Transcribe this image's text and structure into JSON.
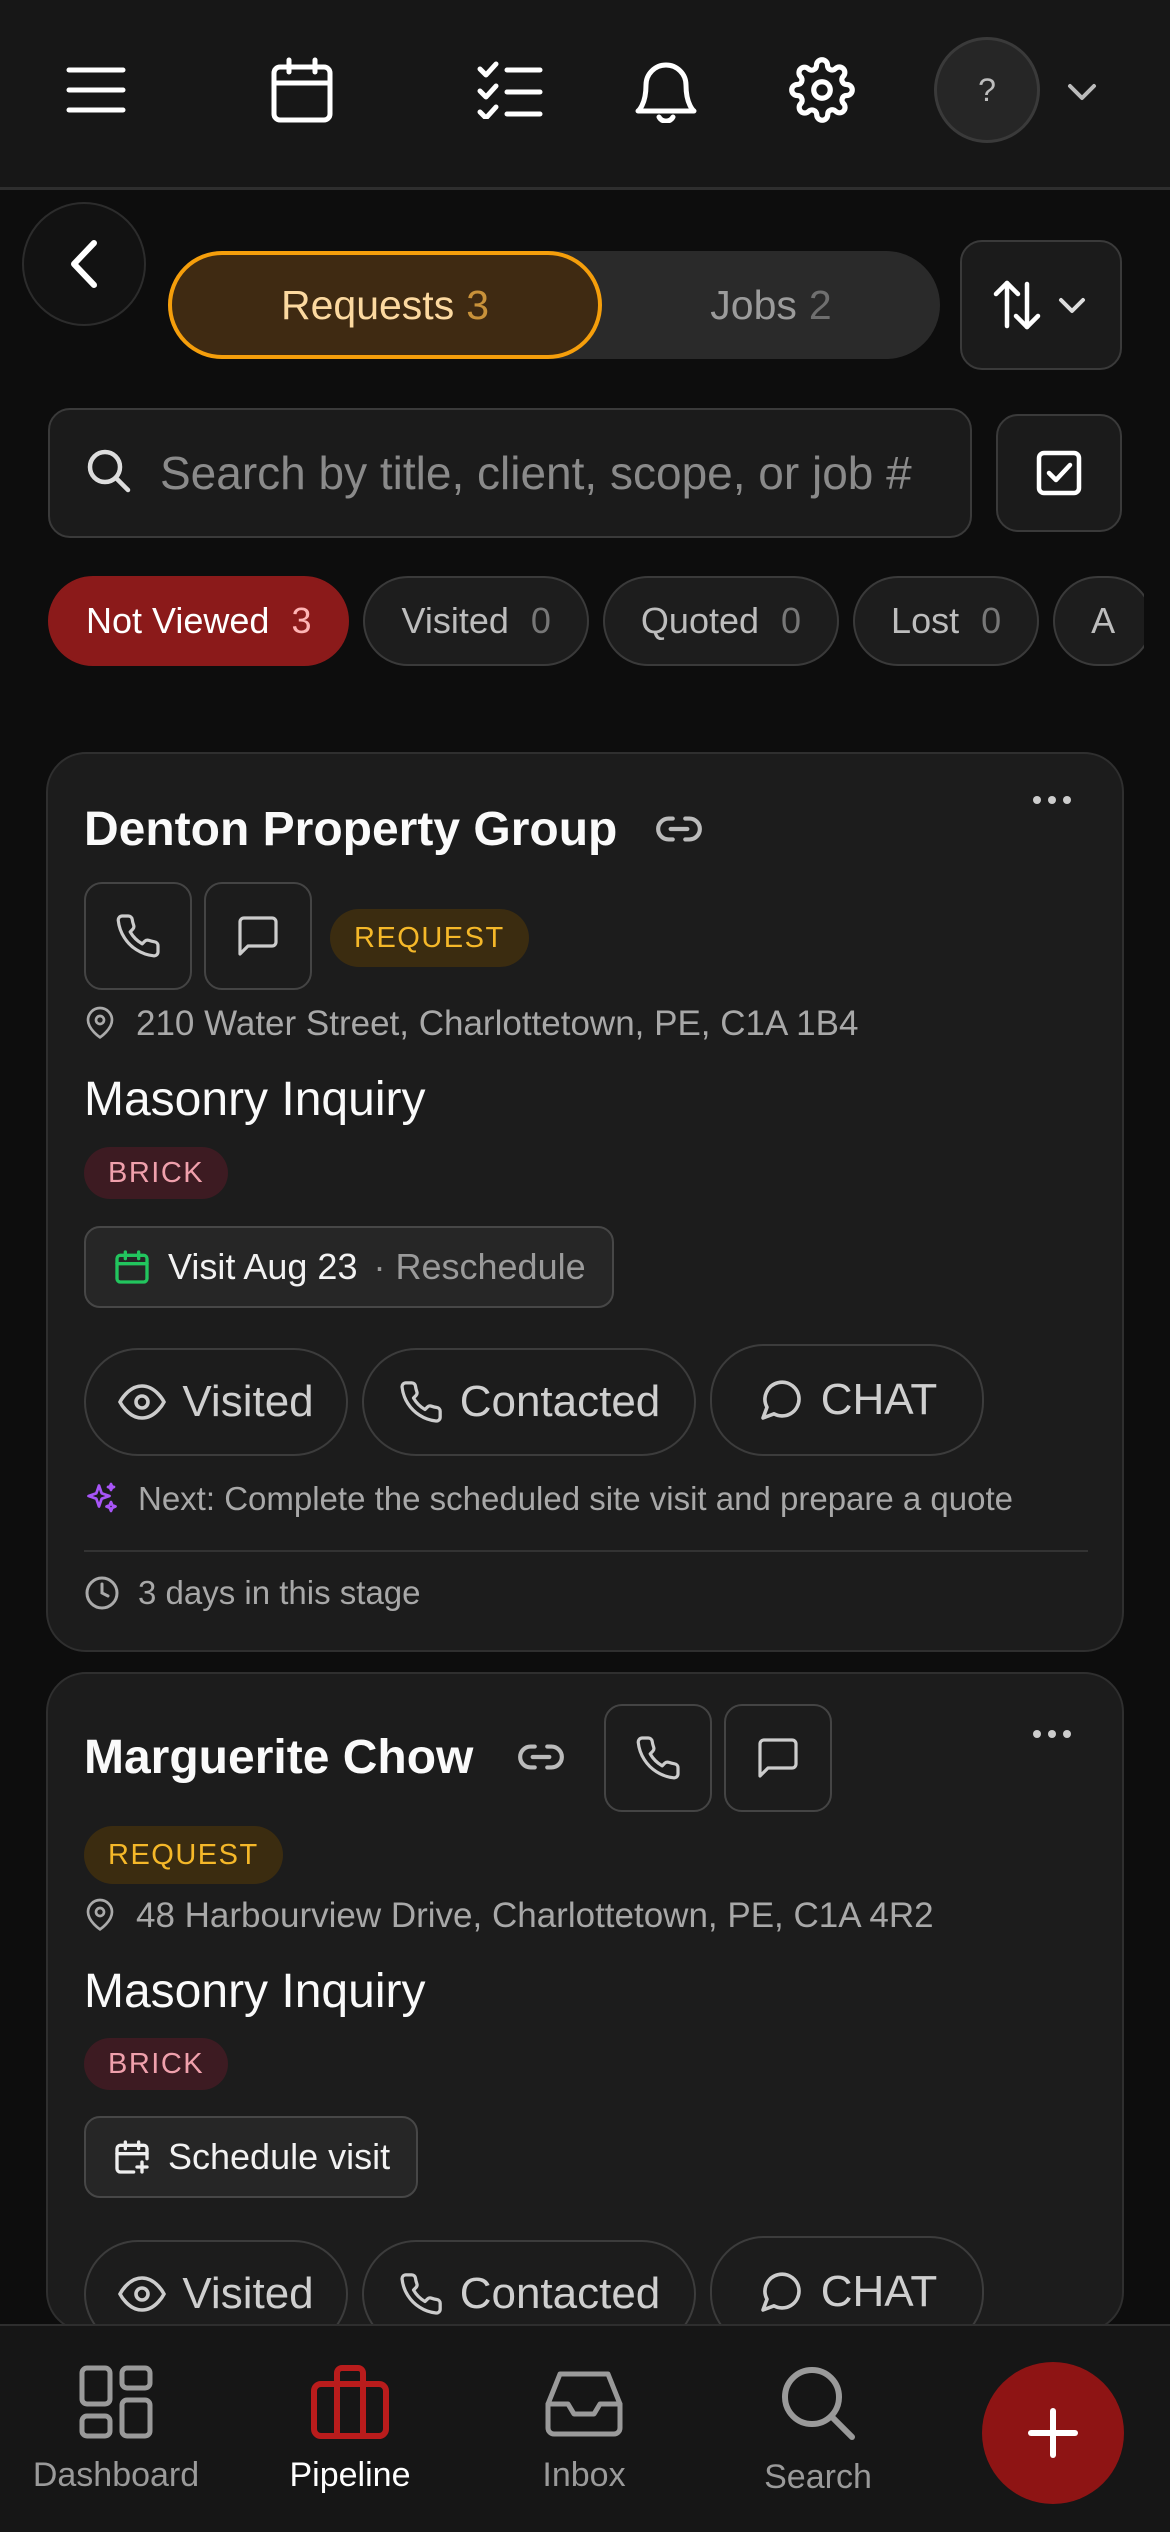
{
  "topbar": {
    "icons": [
      "menu-icon",
      "calendar-icon",
      "checklist-icon",
      "bell-icon",
      "gear-icon",
      "chevron-down-icon"
    ],
    "avatar_text": "?"
  },
  "filters": {
    "tabs": [
      {
        "label": "Requests",
        "count": "3",
        "active": true
      },
      {
        "label": "Jobs",
        "count": "2",
        "active": false
      }
    ],
    "search_placeholder": "Search by title, client, scope, or job #",
    "chips": [
      {
        "label": "Not Viewed",
        "count": "3",
        "active": true
      },
      {
        "label": "Visited",
        "count": "0"
      },
      {
        "label": "Quoted",
        "count": "0"
      },
      {
        "label": "Lost",
        "count": "0"
      },
      {
        "label": "A",
        "count": ""
      }
    ]
  },
  "cards": [
    {
      "client": "Denton Property Group",
      "badge": "REQUEST",
      "address": "210 Water Street, Charlottetown, PE, C1A 1B4",
      "title": "Masonry Inquiry",
      "tag": "BRICK",
      "visit_label": "Visit Aug 23",
      "visit_separator": "·",
      "visit_action": "Reschedule",
      "actions": [
        "Visited",
        "Contacted",
        "CHAT"
      ],
      "next_step": "Next: Complete the scheduled site visit and prepare a quote",
      "stage_time": "3 days in this stage"
    },
    {
      "client": "Marguerite Chow",
      "badge": "REQUEST",
      "address": "48 Harbourview Drive, Charlottetown, PE, C1A 4R2",
      "title": "Masonry Inquiry",
      "tag": "BRICK",
      "schedule_label": "Schedule visit",
      "actions": [
        "Visited",
        "Contacted",
        "CHAT"
      ]
    }
  ],
  "bottom_nav": {
    "items": [
      {
        "label": "Dashboard",
        "icon": "dashboard-icon"
      },
      {
        "label": "Pipeline",
        "icon": "briefcase-icon",
        "active": true
      },
      {
        "label": "Inbox",
        "icon": "inbox-icon"
      },
      {
        "label": "Search",
        "icon": "search-icon"
      }
    ],
    "fab_icon": "plus-icon"
  },
  "colors": {
    "accent_orange": "#f59e0b",
    "accent_red": "#8e1414",
    "request_badge": "#f5b829",
    "brick_badge": "#f0a0ac",
    "visit_green": "#22c55e",
    "sparkle_purple": "#a855f7"
  }
}
